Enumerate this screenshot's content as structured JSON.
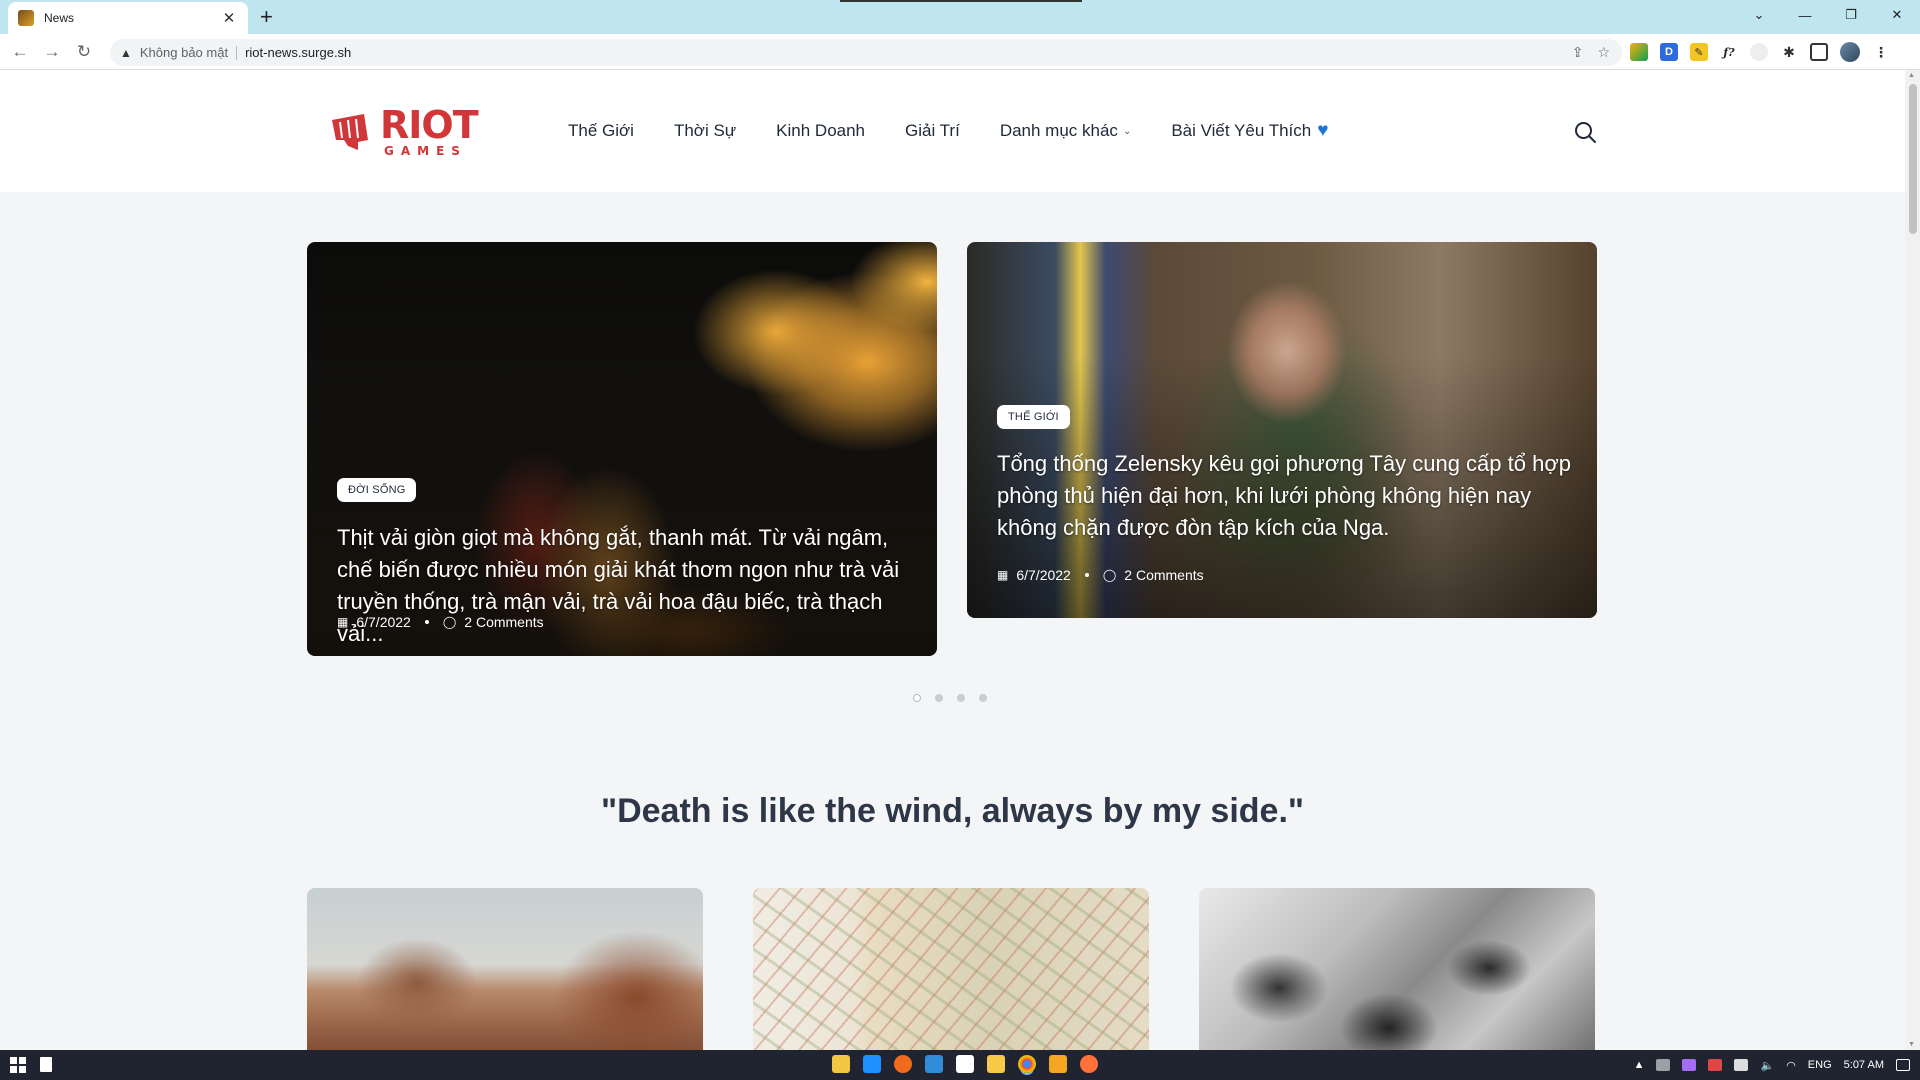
{
  "browser": {
    "tab_title": "News",
    "security_label": "Không bảo mật",
    "url": "riot-news.surge.sh"
  },
  "site": {
    "logo_primary": "RIOT",
    "logo_secondary": "GAMES",
    "brand_color": "#d13639",
    "nav": [
      {
        "label": "Thế Giới"
      },
      {
        "label": "Thời Sự"
      },
      {
        "label": "Kinh Doanh"
      },
      {
        "label": "Giải Trí"
      },
      {
        "label": "Danh mục khác"
      },
      {
        "label": "Bài Viết Yêu Thích"
      }
    ]
  },
  "slider": {
    "slides": [
      {
        "category": "ĐỜI SỐNG",
        "headline": "Thịt vải giòn giọt mà không gắt, thanh mát. Từ vải ngâm, chế biến được nhiều món giải khát thơm ngon như trà vải truyền thống, trà mận vải, trà vải hoa đậu biếc, trà thạch vải...",
        "date": "6/7/2022",
        "comments": "2 Comments"
      },
      {
        "category": "THẾ GIỚI",
        "headline": "Tổng thống Zelensky kêu gọi phương Tây cung cấp tổ hợp phòng thủ hiện đại hơn, khi lưới phòng không hiện nay không chặn được đòn tập kích của Nga.",
        "date": "6/7/2022",
        "comments": "2 Comments"
      }
    ],
    "page_count": 4,
    "active_page": 1
  },
  "quote": "\"Death is like the wind, always by my side.\"",
  "taskbar": {
    "language": "ENG",
    "time": "5:07 AM"
  }
}
